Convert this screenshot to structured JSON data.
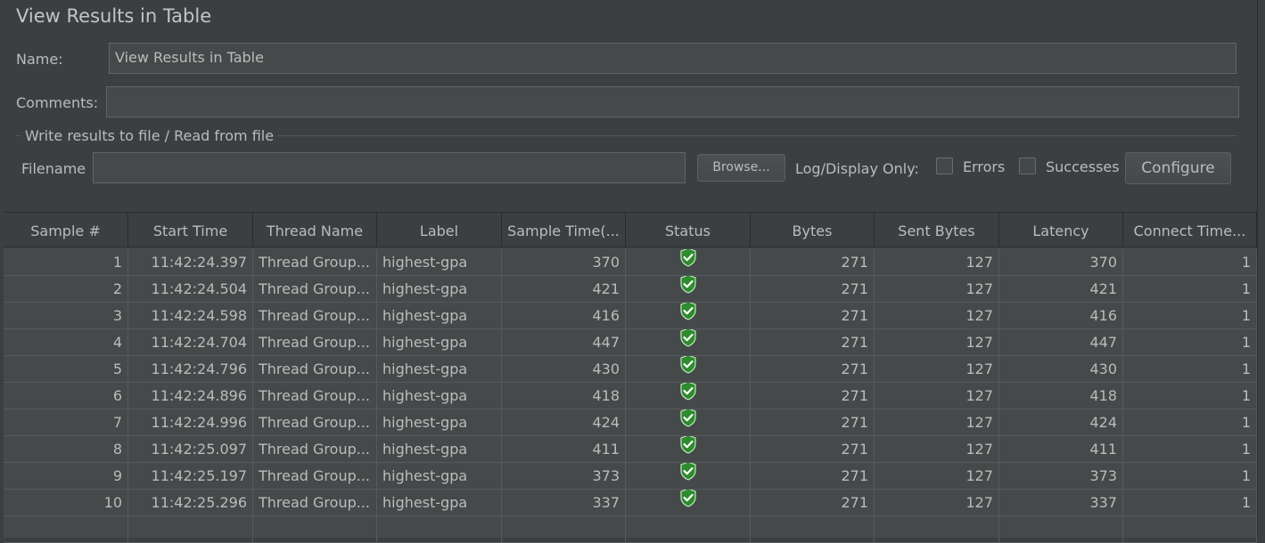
{
  "title": "View Results in Table",
  "name_label": "Name:",
  "name_value": "View Results in Table",
  "comments_label": "Comments:",
  "comments_value": "",
  "group_title": "Write results to file / Read from file",
  "filename_label": "Filename",
  "filename_value": "",
  "browse_label": "Browse...",
  "log_display_label": "Log/Display Only:",
  "errors_label": "Errors",
  "successes_label": "Successes",
  "configure_label": "Configure",
  "columns": [
    "Sample #",
    "Start Time",
    "Thread Name",
    "Label",
    "Sample Time(...",
    "Status",
    "Bytes",
    "Sent Bytes",
    "Latency",
    "Connect Time..."
  ],
  "rows": [
    {
      "sample": "1",
      "start": "11:42:24.397",
      "thread": "Thread Group...",
      "label": "highest-gpa",
      "time": "370",
      "status": "success",
      "bytes": "271",
      "sent": "127",
      "latency": "370",
      "connect": "1"
    },
    {
      "sample": "2",
      "start": "11:42:24.504",
      "thread": "Thread Group...",
      "label": "highest-gpa",
      "time": "421",
      "status": "success",
      "bytes": "271",
      "sent": "127",
      "latency": "421",
      "connect": "1"
    },
    {
      "sample": "3",
      "start": "11:42:24.598",
      "thread": "Thread Group...",
      "label": "highest-gpa",
      "time": "416",
      "status": "success",
      "bytes": "271",
      "sent": "127",
      "latency": "416",
      "connect": "1"
    },
    {
      "sample": "4",
      "start": "11:42:24.704",
      "thread": "Thread Group...",
      "label": "highest-gpa",
      "time": "447",
      "status": "success",
      "bytes": "271",
      "sent": "127",
      "latency": "447",
      "connect": "1"
    },
    {
      "sample": "5",
      "start": "11:42:24.796",
      "thread": "Thread Group...",
      "label": "highest-gpa",
      "time": "430",
      "status": "success",
      "bytes": "271",
      "sent": "127",
      "latency": "430",
      "connect": "1"
    },
    {
      "sample": "6",
      "start": "11:42:24.896",
      "thread": "Thread Group...",
      "label": "highest-gpa",
      "time": "418",
      "status": "success",
      "bytes": "271",
      "sent": "127",
      "latency": "418",
      "connect": "1"
    },
    {
      "sample": "7",
      "start": "11:42:24.996",
      "thread": "Thread Group...",
      "label": "highest-gpa",
      "time": "424",
      "status": "success",
      "bytes": "271",
      "sent": "127",
      "latency": "424",
      "connect": "1"
    },
    {
      "sample": "8",
      "start": "11:42:25.097",
      "thread": "Thread Group...",
      "label": "highest-gpa",
      "time": "411",
      "status": "success",
      "bytes": "271",
      "sent": "127",
      "latency": "411",
      "connect": "1"
    },
    {
      "sample": "9",
      "start": "11:42:25.197",
      "thread": "Thread Group...",
      "label": "highest-gpa",
      "time": "373",
      "status": "success",
      "bytes": "271",
      "sent": "127",
      "latency": "373",
      "connect": "1"
    },
    {
      "sample": "10",
      "start": "11:42:25.296",
      "thread": "Thread Group...",
      "label": "highest-gpa",
      "time": "337",
      "status": "success",
      "bytes": "271",
      "sent": "127",
      "latency": "337",
      "connect": "1"
    }
  ],
  "status_icon": "green-shield-check-icon",
  "colors": {
    "background": "#3c3f41",
    "field": "#45494a",
    "success": "#3fb33f"
  }
}
